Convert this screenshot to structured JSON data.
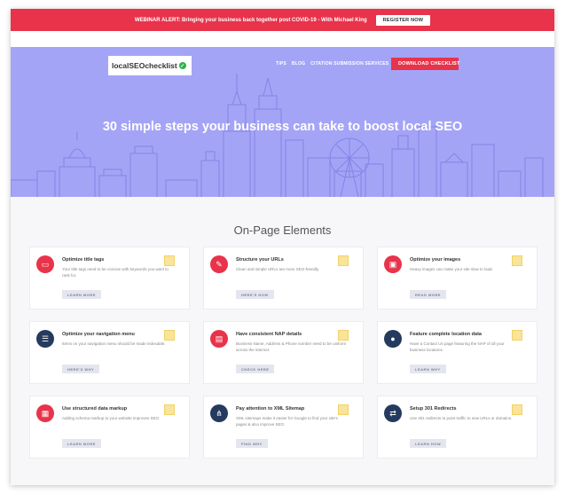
{
  "alert": {
    "text": "WEBINAR ALERT: Bringing your business back together post COVID-19 - With Michael King",
    "button": "REGISTER NOW"
  },
  "logo": {
    "text": "localSEOchecklist"
  },
  "nav": {
    "items": [
      "TIPS",
      "BLOG",
      "CITATION SUBMISSION SERVICES"
    ],
    "cta": "DOWNLOAD CHECKLIST"
  },
  "hero": {
    "headline": "30 simple steps your business can take to boost local SEO"
  },
  "section": {
    "title": "On-Page Elements"
  },
  "colors": {
    "alert": "#e8334a",
    "hero": "#a4a4f7",
    "button": "#e4e6ef",
    "marker": "#f8e49a"
  },
  "cards": [
    {
      "title": "Optimize title tags",
      "desc": "Your title tags need to be concise with keywords you want to rank for.",
      "button": "LEARN MORE",
      "icon": "browser-icon",
      "icon_color": "#e8334a"
    },
    {
      "title": "Structure your URLs",
      "desc": "Clean and simple URLs are more SEO-friendly.",
      "button": "HERE'S HOW",
      "icon": "pencil-icon",
      "icon_color": "#e8334a"
    },
    {
      "title": "Optimize your images",
      "desc": "Heavy images can make your site slow to load.",
      "button": "READ MORE",
      "icon": "image-icon",
      "icon_color": "#e8334a"
    },
    {
      "title": "Optimize your navigation menu",
      "desc": "Items on your navigation menu should be made indexable.",
      "button": "HERE'S WHY",
      "icon": "menu-icon",
      "icon_color": "#243a5e"
    },
    {
      "title": "Have consistent NAP details",
      "desc": "Business Name, Address & Phone number need to be uniform across the internet.",
      "button": "CHECK HERE",
      "icon": "location-card-icon",
      "icon_color": "#e8334a"
    },
    {
      "title": "Feature complete location data",
      "desc": "Have a Contact Us page featuring the NAP of all your business locations.",
      "button": "LEARN WHY",
      "icon": "map-pin-icon",
      "icon_color": "#243a5e"
    },
    {
      "title": "Use structured data markup",
      "desc": "Adding schema markup to your website improves SEO.",
      "button": "LEARN MORE",
      "icon": "document-icon",
      "icon_color": "#e8334a"
    },
    {
      "title": "Pay attention to XML Sitemap",
      "desc": "XML sitemaps make it easier for Google to find your site's pages & also improve SEO.",
      "button": "FIND WHY",
      "icon": "sitemap-icon",
      "icon_color": "#243a5e"
    },
    {
      "title": "Setup 301 Redirects",
      "desc": "Use 301 redirects to point traffic to new URLs or domains.",
      "button": "LEARN HOW",
      "icon": "redirect-icon",
      "icon_color": "#243a5e"
    }
  ]
}
